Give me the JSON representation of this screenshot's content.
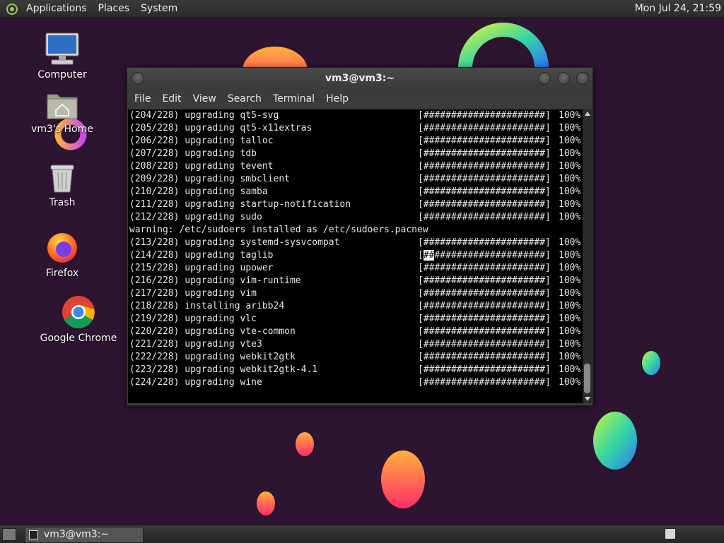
{
  "top_panel": {
    "menus": [
      "Applications",
      "Places",
      "System"
    ],
    "clock": "Mon Jul 24, 21:59"
  },
  "desktop_icons": [
    {
      "label": "Computer",
      "icon": "computer-icon"
    },
    {
      "label": "vm3's Home",
      "icon": "home-folder-icon"
    },
    {
      "label": "Trash",
      "icon": "trash-icon"
    },
    {
      "label": "Firefox",
      "icon": "firefox-icon"
    },
    {
      "label": "Google Chrome",
      "icon": "chrome-icon"
    }
  ],
  "terminal": {
    "title": "vm3@vm3:~",
    "menus": [
      "File",
      "Edit",
      "View",
      "Search",
      "Terminal",
      "Help"
    ],
    "lines": [
      {
        "text": "(204/228) upgrading qt5-svg",
        "bar": "[######################]",
        "pct": "100%"
      },
      {
        "text": "(205/228) upgrading qt5-x11extras",
        "bar": "[######################]",
        "pct": "100%"
      },
      {
        "text": "(206/228) upgrading talloc",
        "bar": "[######################]",
        "pct": "100%"
      },
      {
        "text": "(207/228) upgrading tdb",
        "bar": "[######################]",
        "pct": "100%"
      },
      {
        "text": "(208/228) upgrading tevent",
        "bar": "[######################]",
        "pct": "100%"
      },
      {
        "text": "(209/228) upgrading smbclient",
        "bar": "[######################]",
        "pct": "100%"
      },
      {
        "text": "(210/228) upgrading samba",
        "bar": "[######################]",
        "pct": "100%"
      },
      {
        "text": "(211/228) upgrading startup-notification",
        "bar": "[######################]",
        "pct": "100%"
      },
      {
        "text": "(212/228) upgrading sudo",
        "bar": "[######################]",
        "pct": "100%"
      },
      {
        "text": "warning: /etc/sudoers installed as /etc/sudoers.pacnew",
        "bar": "",
        "pct": ""
      },
      {
        "text": "(213/228) upgrading systemd-sysvcompat",
        "bar": "[######################]",
        "pct": "100%"
      },
      {
        "text": "(214/228) upgrading taglib",
        "bar": "[######################]",
        "pct": "100%"
      },
      {
        "text": "(215/228) upgrading upower",
        "bar": "[######################]",
        "pct": "100%"
      },
      {
        "text": "(216/228) upgrading vim-runtime",
        "bar": "[######################]",
        "pct": "100%"
      },
      {
        "text": "(217/228) upgrading vim",
        "bar": "[######################]",
        "pct": "100%"
      },
      {
        "text": "(218/228) installing aribb24",
        "bar": "[######################]",
        "pct": "100%"
      },
      {
        "text": "(219/228) upgrading vlc",
        "bar": "[######################]",
        "pct": "100%"
      },
      {
        "text": "(220/228) upgrading vte-common",
        "bar": "[######################]",
        "pct": "100%"
      },
      {
        "text": "(221/228) upgrading vte3",
        "bar": "[######################]",
        "pct": "100%"
      },
      {
        "text": "(222/228) upgrading webkit2gtk",
        "bar": "[######################]",
        "pct": "100%"
      },
      {
        "text": "(223/228) upgrading webkit2gtk-4.1",
        "bar": "[######################]",
        "pct": "100%"
      },
      {
        "text": "(224/228) upgrading wine",
        "bar": "[######################]",
        "pct": "100%"
      }
    ]
  },
  "taskbar": {
    "task_label": "vm3@vm3:~"
  },
  "colors": {
    "wallpaper": "#2d1430",
    "terminal_bg": "#000000",
    "panel": "#2f2f2f"
  }
}
